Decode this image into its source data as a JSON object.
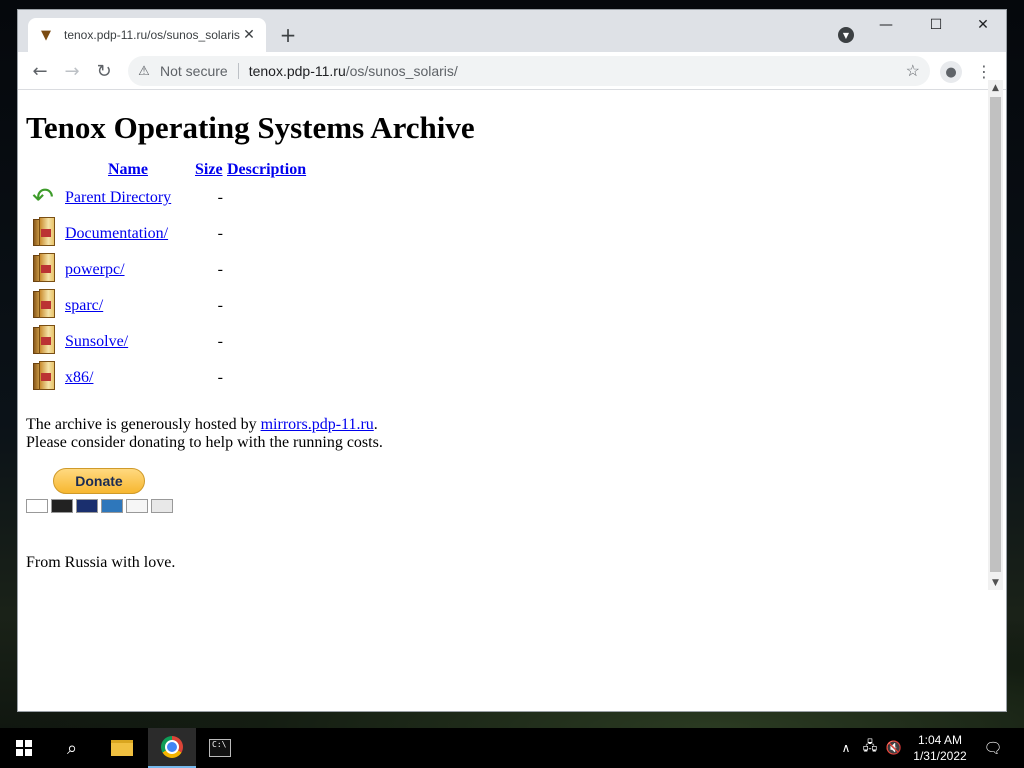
{
  "browser": {
    "tab_title": "tenox.pdp-11.ru/os/sunos_solaris/",
    "security_label": "Not secure",
    "url_host": "tenox.pdp-11.ru",
    "url_path": "/os/sunos_solaris/"
  },
  "page": {
    "title": "Tenox Operating Systems Archive",
    "columns": {
      "name": "Name",
      "size": "Size",
      "description": "Description"
    },
    "entries": [
      {
        "name": "Parent Directory",
        "size": "-",
        "icon": "back-arrow-icon"
      },
      {
        "name": "Documentation/",
        "size": "-",
        "icon": "folder-icon"
      },
      {
        "name": "powerpc/",
        "size": "-",
        "icon": "folder-icon"
      },
      {
        "name": "sparc/",
        "size": "-",
        "icon": "folder-icon"
      },
      {
        "name": "Sunsolve/",
        "size": "-",
        "icon": "folder-icon"
      },
      {
        "name": "x86/",
        "size": "-",
        "icon": "folder-icon"
      }
    ],
    "hosted_prefix": "The archive is generously hosted by ",
    "hosted_link": "mirrors.pdp-11.ru",
    "hosted_suffix": ".",
    "donate_note": "Please consider donating to help with the running costs.",
    "donate_label": "Donate",
    "footer": "From Russia with love."
  },
  "taskbar": {
    "time": "1:04 AM",
    "date": "1/31/2022"
  },
  "colors": {
    "link": "#0000ee",
    "donate_button": "#f7b730",
    "taskbar": "#000000"
  }
}
